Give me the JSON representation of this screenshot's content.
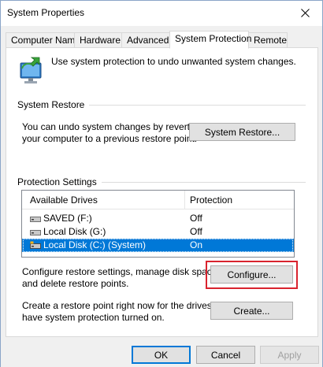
{
  "window": {
    "title": "System Properties",
    "close_icon": "close-icon"
  },
  "tabs": [
    {
      "label": "Computer Name",
      "active": false
    },
    {
      "label": "Hardware",
      "active": false
    },
    {
      "label": "Advanced",
      "active": false
    },
    {
      "label": "System Protection",
      "active": true
    },
    {
      "label": "Remote",
      "active": false
    }
  ],
  "intro": {
    "icon": "system-protection-icon",
    "text": "Use system protection to undo unwanted system changes."
  },
  "system_restore": {
    "group_label": "System Restore",
    "description_line1": "You can undo system changes by reverting",
    "description_line2": "your computer to a previous restore point.",
    "button_label": "System Restore..."
  },
  "protection_settings": {
    "group_label": "Protection Settings",
    "columns": [
      "Available Drives",
      "Protection"
    ],
    "drives": [
      {
        "name": "SAVED (F:)",
        "protection": "Off",
        "icon": "drive-icon",
        "selected": false
      },
      {
        "name": "Local Disk (G:)",
        "protection": "Off",
        "icon": "drive-icon",
        "selected": false
      },
      {
        "name": "Local Disk (C:) (System)",
        "protection": "On",
        "icon": "system-drive-icon",
        "selected": true
      }
    ]
  },
  "configure": {
    "text_line1": "Configure restore settings, manage disk space,",
    "text_line2": "and delete restore points.",
    "button_label": "Configure..."
  },
  "create": {
    "text_line1": "Create a restore point right now for the drives that",
    "text_line2": "have system protection turned on.",
    "button_label": "Create..."
  },
  "footer": {
    "ok_label": "OK",
    "cancel_label": "Cancel",
    "apply_label": "Apply"
  },
  "colors": {
    "selection": "#0078d7",
    "highlight_box": "#d9232e"
  }
}
